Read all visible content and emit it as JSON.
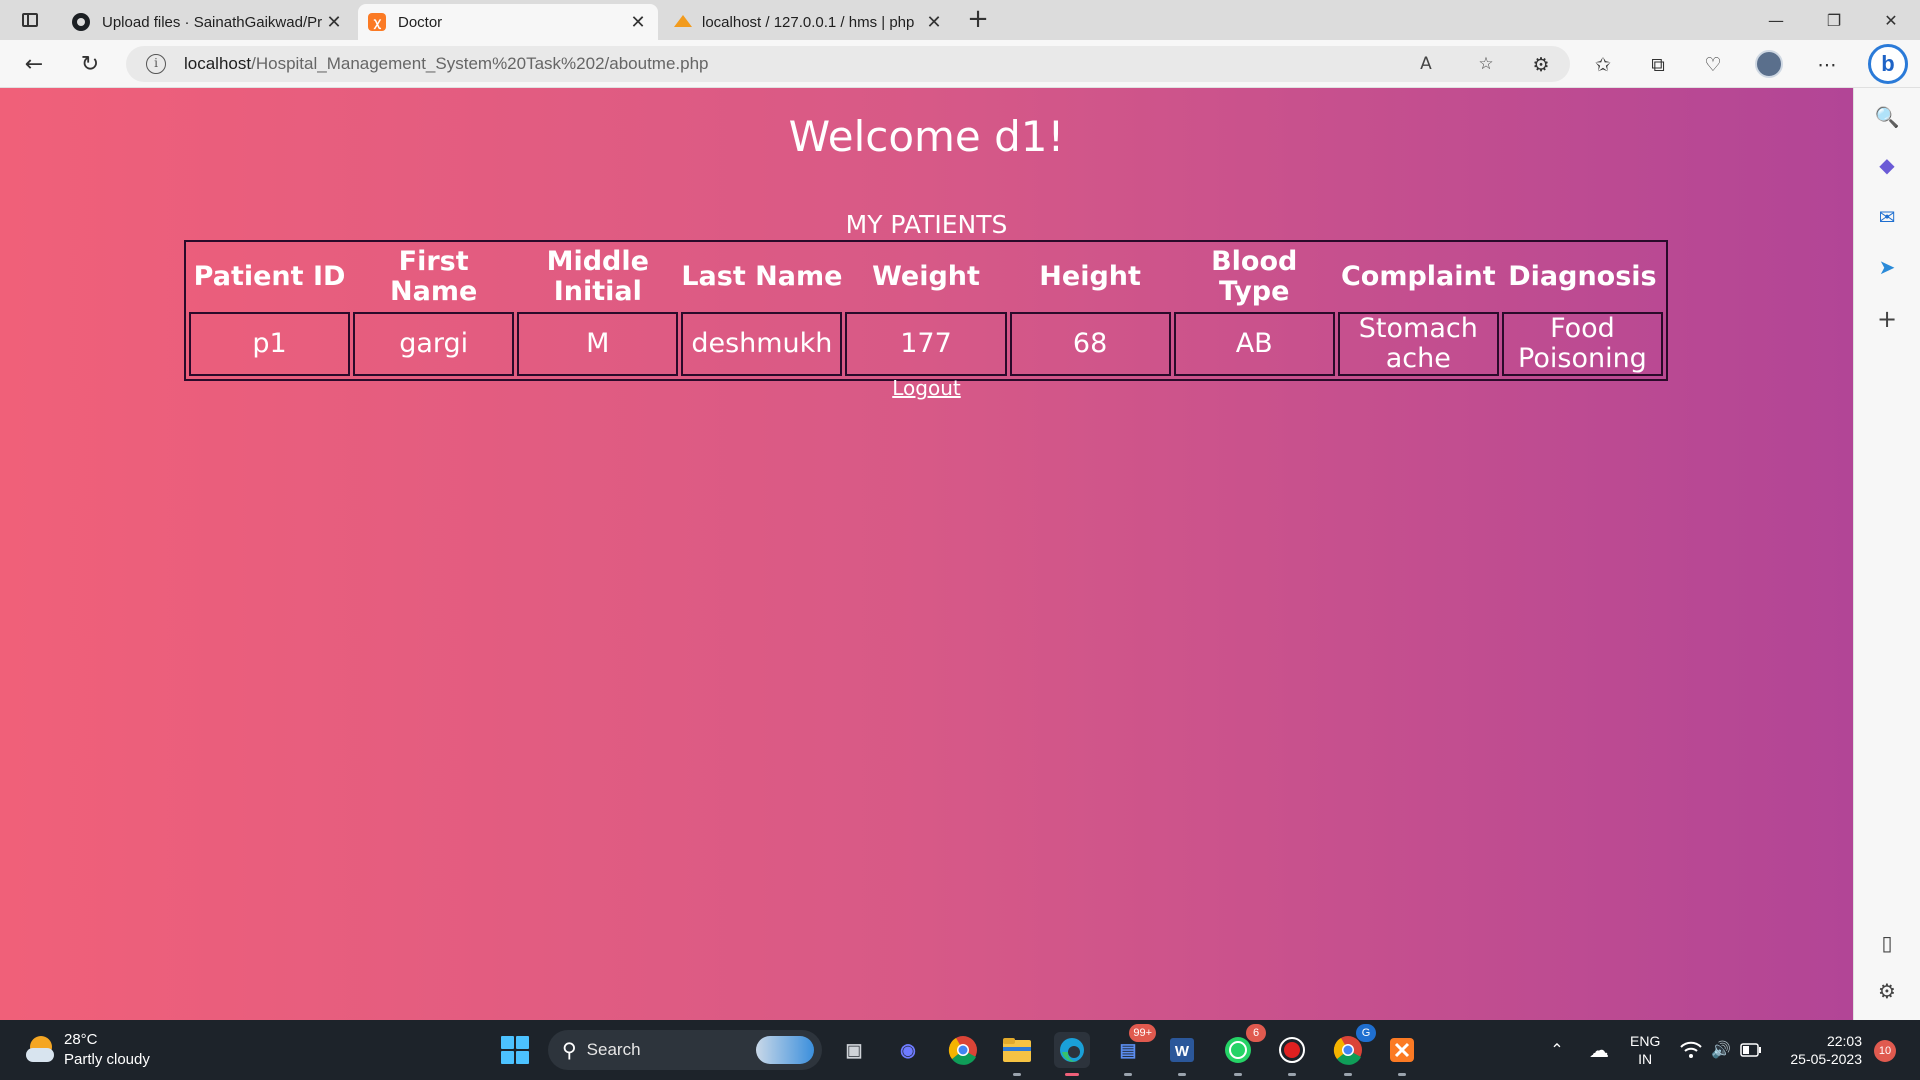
{
  "browser": {
    "tabs": [
      {
        "title": "Upload files · SainathGaikwad/Pr",
        "favicon": "github-icon"
      },
      {
        "title": "Doctor",
        "favicon": "xampp-icon"
      },
      {
        "title": "localhost / 127.0.0.1 / hms | php",
        "favicon": "phpmyadmin-icon"
      }
    ],
    "url_host": "localhost",
    "url_path": "/Hospital_Management_System%20Task%202/aboutme.php"
  },
  "page": {
    "welcome": "Welcome d1!",
    "caption": "MY PATIENTS",
    "columns": [
      "Patient ID",
      "First Name",
      "Middle Initial",
      "Last Name",
      "Weight",
      "Height",
      "Blood Type",
      "Complaint",
      "Diagnosis"
    ],
    "rows": [
      [
        "p1",
        "gargi",
        "M",
        "deshmukh",
        "177",
        "68",
        "AB",
        "Stomach ache",
        "Food Poisoning"
      ]
    ],
    "logout": "Logout"
  },
  "taskbar": {
    "temperature": "28°C",
    "weather": "Partly cloudy",
    "search": "Search",
    "badges": {
      "teams": "99+",
      "whatsapp": "6",
      "chrome": "G"
    },
    "lang_top": "ENG",
    "lang_bottom": "IN",
    "time": "22:03",
    "date": "25-05-2023",
    "notifications": "10"
  },
  "colors": {
    "gradient_start": "#f06079",
    "gradient_end": "#b24596",
    "table_border": "#2a0a2a"
  }
}
